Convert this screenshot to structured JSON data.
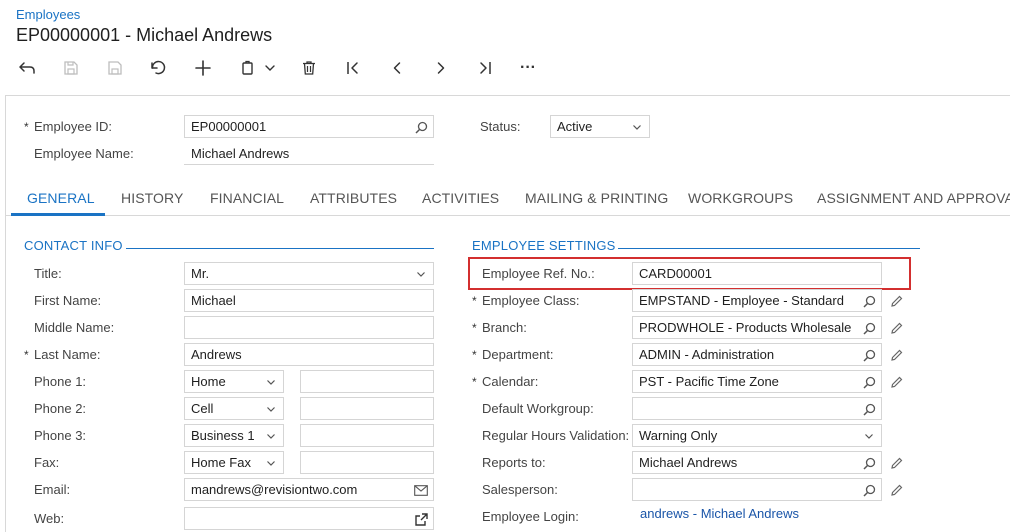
{
  "header": {
    "breadcrumb": "Employees",
    "title": "EP00000001 - Michael Andrews"
  },
  "toolbar": {
    "buttons": [
      "back-icon",
      "save-close-icon",
      "save-icon",
      "undo-icon",
      "add-icon",
      "copy-paste-icon",
      "delete-icon",
      "first-icon",
      "previous-icon",
      "next-icon",
      "last-icon",
      "more-icon"
    ],
    "more_label": "···"
  },
  "summary": {
    "employee_id_label": "Employee ID:",
    "employee_id": "EP00000001",
    "employee_name_label": "Employee Name:",
    "employee_name": "Michael Andrews",
    "status_label": "Status:",
    "status": "Active"
  },
  "tabs": [
    {
      "label": "GENERAL"
    },
    {
      "label": "HISTORY"
    },
    {
      "label": "FINANCIAL"
    },
    {
      "label": "ATTRIBUTES"
    },
    {
      "label": "ACTIVITIES"
    },
    {
      "label": "MAILING & PRINTING"
    },
    {
      "label": "WORKGROUPS"
    },
    {
      "label": "ASSIGNMENT AND APPROVAL MAPS"
    }
  ],
  "contact": {
    "section_title": "CONTACT INFO",
    "title_label": "Title:",
    "title": "Mr.",
    "first_name_label": "First Name:",
    "first_name": "Michael",
    "middle_name_label": "Middle Name:",
    "middle_name": "",
    "last_name_label": "Last Name:",
    "last_name": "Andrews",
    "phone1_label": "Phone 1:",
    "phone1_type": "Home",
    "phone1": "",
    "phone2_label": "Phone 2:",
    "phone2_type": "Cell",
    "phone2": "",
    "phone3_label": "Phone 3:",
    "phone3_type": "Business 1",
    "phone3": "",
    "fax_label": "Fax:",
    "fax_type": "Home Fax",
    "fax": "",
    "email_label": "Email:",
    "email": "mandrews@revisiontwo.com",
    "web_label": "Web:",
    "web": ""
  },
  "settings": {
    "section_title": "EMPLOYEE SETTINGS",
    "ref_no_label": "Employee Ref. No.:",
    "ref_no": "CARD00001",
    "class_label": "Employee Class:",
    "class": "EMPSTAND - Employee - Standard",
    "branch_label": "Branch:",
    "branch": "PRODWHOLE - Products Wholesale",
    "department_label": "Department:",
    "department": "ADMIN - Administration",
    "calendar_label": "Calendar:",
    "calendar": "PST - Pacific Time Zone",
    "workgroup_label": "Default Workgroup:",
    "workgroup": "",
    "hours_validation_label": "Regular Hours Validation:",
    "hours_validation": "Warning Only",
    "reports_to_label": "Reports to:",
    "reports_to": "Michael Andrews",
    "salesperson_label": "Salesperson:",
    "salesperson": "",
    "login_label": "Employee Login:",
    "login": "andrews - Michael Andrews"
  },
  "colors": {
    "accent": "#1a73c4",
    "highlight": "#d32f2f"
  }
}
